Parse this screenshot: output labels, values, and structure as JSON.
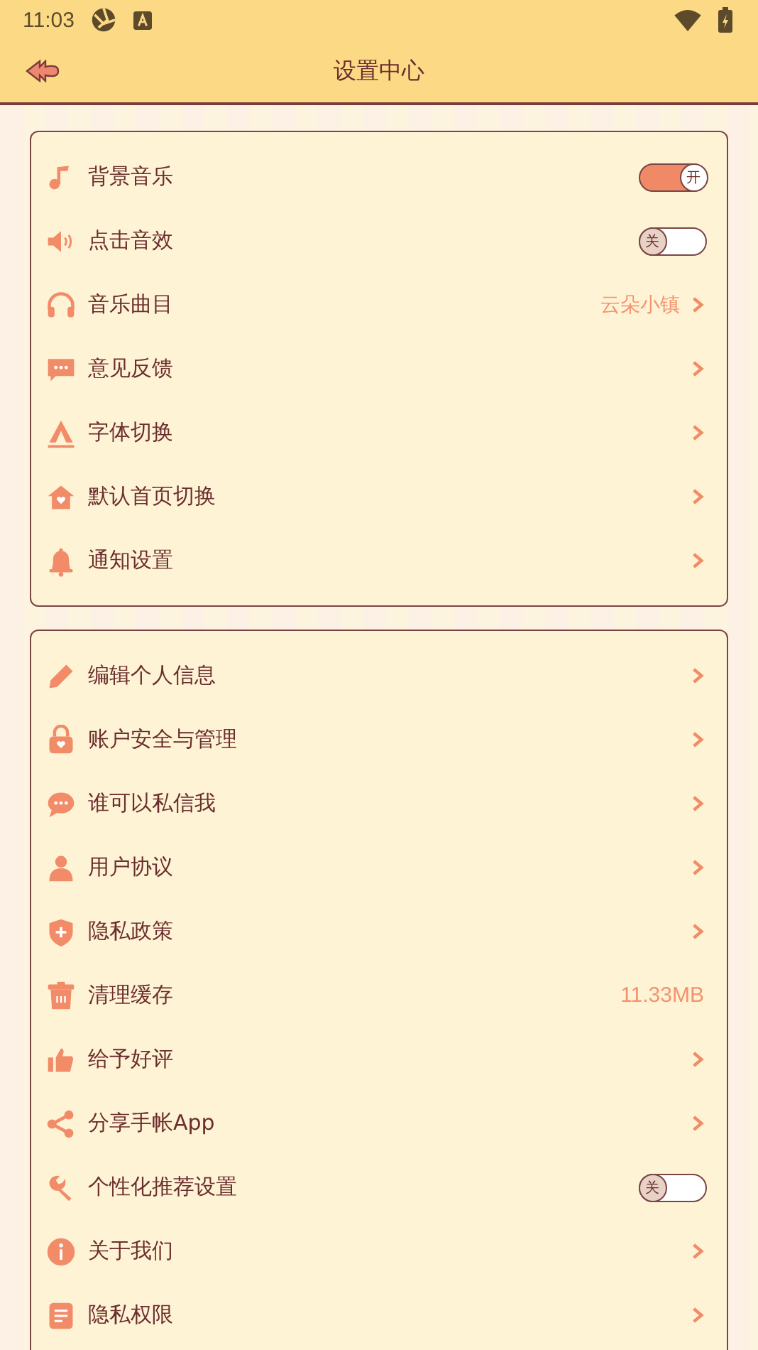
{
  "status_bar": {
    "time": "11:03"
  },
  "header": {
    "title": "设置中心"
  },
  "sections": [
    {
      "rows": [
        {
          "kind": "toggle",
          "label": "背景音乐",
          "on": true,
          "toggle_text": "开"
        },
        {
          "kind": "toggle",
          "label": "点击音效",
          "on": false,
          "toggle_text": "关"
        },
        {
          "kind": "link",
          "label": "音乐曲目",
          "value": "云朵小镇"
        },
        {
          "kind": "link",
          "label": "意见反馈"
        },
        {
          "kind": "link",
          "label": "字体切换"
        },
        {
          "kind": "link",
          "label": "默认首页切换"
        },
        {
          "kind": "link",
          "label": "通知设置"
        }
      ]
    },
    {
      "rows": [
        {
          "kind": "link",
          "label": "编辑个人信息"
        },
        {
          "kind": "link",
          "label": "账户安全与管理"
        },
        {
          "kind": "link",
          "label": "谁可以私信我"
        },
        {
          "kind": "link",
          "label": "用户协议"
        },
        {
          "kind": "link",
          "label": "隐私政策"
        },
        {
          "kind": "value",
          "label": "清理缓存",
          "value": "11.33MB"
        },
        {
          "kind": "link",
          "label": "给予好评"
        },
        {
          "kind": "link",
          "label": "分享手帐App"
        },
        {
          "kind": "toggle",
          "label": "个性化推荐设置",
          "on": false,
          "toggle_text": "关"
        },
        {
          "kind": "link",
          "label": "关于我们"
        },
        {
          "kind": "link",
          "label": "隐私权限"
        }
      ]
    }
  ]
}
